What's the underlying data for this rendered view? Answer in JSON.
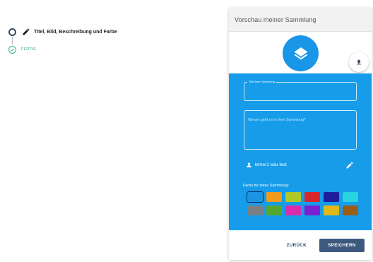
{
  "stepper": {
    "current_step_label": "Titel, Bild, Beschreibung und Farbe",
    "done_label": "FERTIG"
  },
  "preview": {
    "header_title": "Vorschau meiner Sammlung",
    "image_icon": "layers-icon",
    "upload_icon": "upload-icon",
    "title_field": {
      "label": "Titel Ihrer Sammlung",
      "value": ""
    },
    "description_field": {
      "placeholder": "Worum geht es in Ihrer Sammlung?",
      "value": ""
    },
    "owner": {
      "icon": "person-icon",
      "name": "lehrer1 edu-test"
    },
    "edit_icon": "pencil-icon",
    "color_label": "Farbe für diese Sammlung:",
    "colors": [
      {
        "hex": "#1a95e6",
        "selected": true
      },
      {
        "hex": "#ee9a1a",
        "selected": false
      },
      {
        "hex": "#aec826",
        "selected": false
      },
      {
        "hex": "#d7272c",
        "selected": false
      },
      {
        "hex": "#1e1e9a",
        "selected": false
      },
      {
        "hex": "#29d3e0",
        "selected": false
      },
      {
        "hex": "#7b8087",
        "selected": false
      },
      {
        "hex": "#55a82b",
        "selected": false
      },
      {
        "hex": "#d92dac",
        "selected": false
      },
      {
        "hex": "#7a1fd2",
        "selected": false
      },
      {
        "hex": "#e0b81b",
        "selected": false
      },
      {
        "hex": "#9a5e17",
        "selected": false
      }
    ]
  },
  "footer": {
    "back_label": "ZURÜCK",
    "save_label": "SPEICHERN"
  },
  "colors": {
    "blue_panel": "#169ce9",
    "accent_green": "#2db577",
    "save_button": "#3d5a7e"
  }
}
